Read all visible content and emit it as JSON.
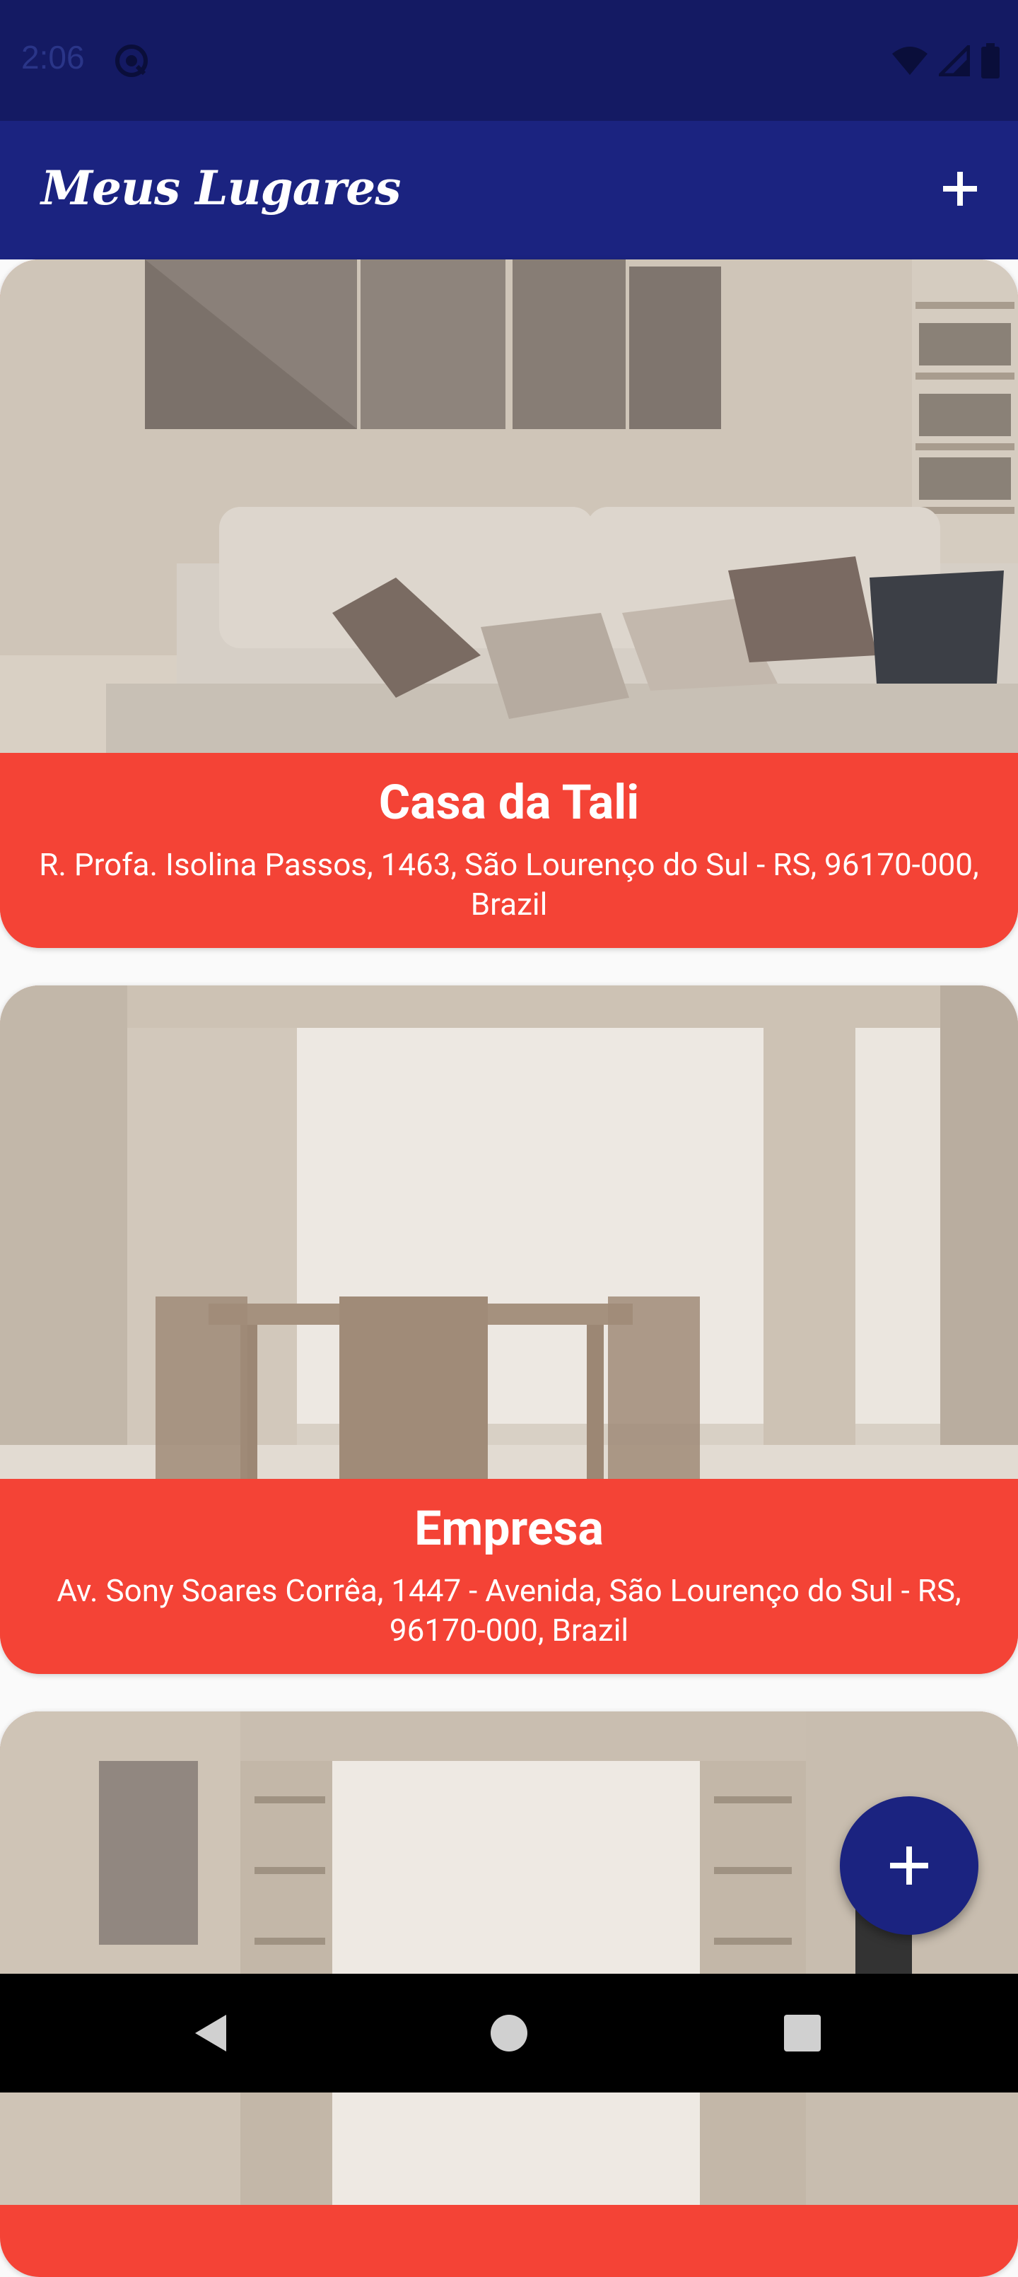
{
  "status_bar": {
    "time": "2:06",
    "icons": [
      "app-notification-icon",
      "wifi-icon",
      "signal-icon",
      "battery-icon"
    ]
  },
  "app_bar": {
    "title": "Meus Lugares",
    "add_icon": "plus-icon"
  },
  "places": [
    {
      "title": "Casa da Tali",
      "address": "R. Profa. Isolina Passos, 1463, São Lourenço do Sul - RS, 96170-000, Brazil",
      "image": "living-room-photo"
    },
    {
      "title": "Empresa",
      "address": "Av. Sony Soares Corrêa, 1447 - Avenida, São Lourenço do Sul - RS, 96170-000, Brazil",
      "image": "dining-room-photo"
    },
    {
      "title": "",
      "address": "",
      "image": "room-with-shelves-photo"
    }
  ],
  "fab": {
    "icon": "plus-icon"
  },
  "nav_bar": {
    "buttons": [
      "back-icon",
      "home-icon",
      "recents-icon"
    ]
  },
  "colors": {
    "status_bar": "#141a63",
    "app_bar": "#1b2380",
    "card_info": "#f44336",
    "fab": "#1b2380",
    "background": "#fafafa"
  }
}
